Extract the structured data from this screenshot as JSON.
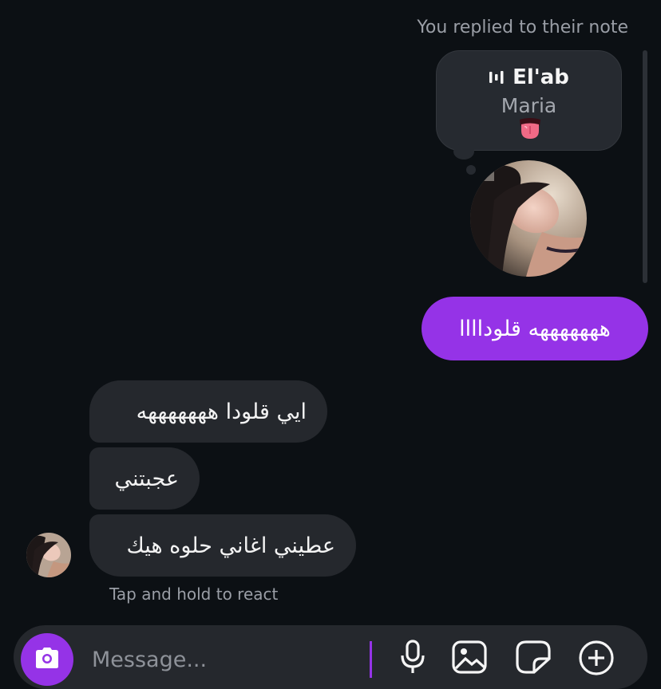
{
  "reply_caption": "You replied to their note",
  "note": {
    "title": "El'ab",
    "subtitle": "Maria",
    "emoji": "tongue-out-mouth"
  },
  "sent_message": "هههههههه قلوداااا",
  "received_messages": [
    "ايي قلودا هههههههه",
    "عجبتني",
    "عطيني اغاني حلوه هيك"
  ],
  "react_hint": "Tap and hold to react",
  "composer": {
    "placeholder": "Message...",
    "value": ""
  },
  "colors": {
    "background": "#0c1014",
    "sent_bubble": "#9533e7",
    "received_bubble": "#25282d",
    "accent": "#9533e7"
  },
  "icons": [
    "sound-bars-icon",
    "camera-icon",
    "microphone-icon",
    "gallery-icon",
    "sticker-icon",
    "plus-circle-icon"
  ]
}
